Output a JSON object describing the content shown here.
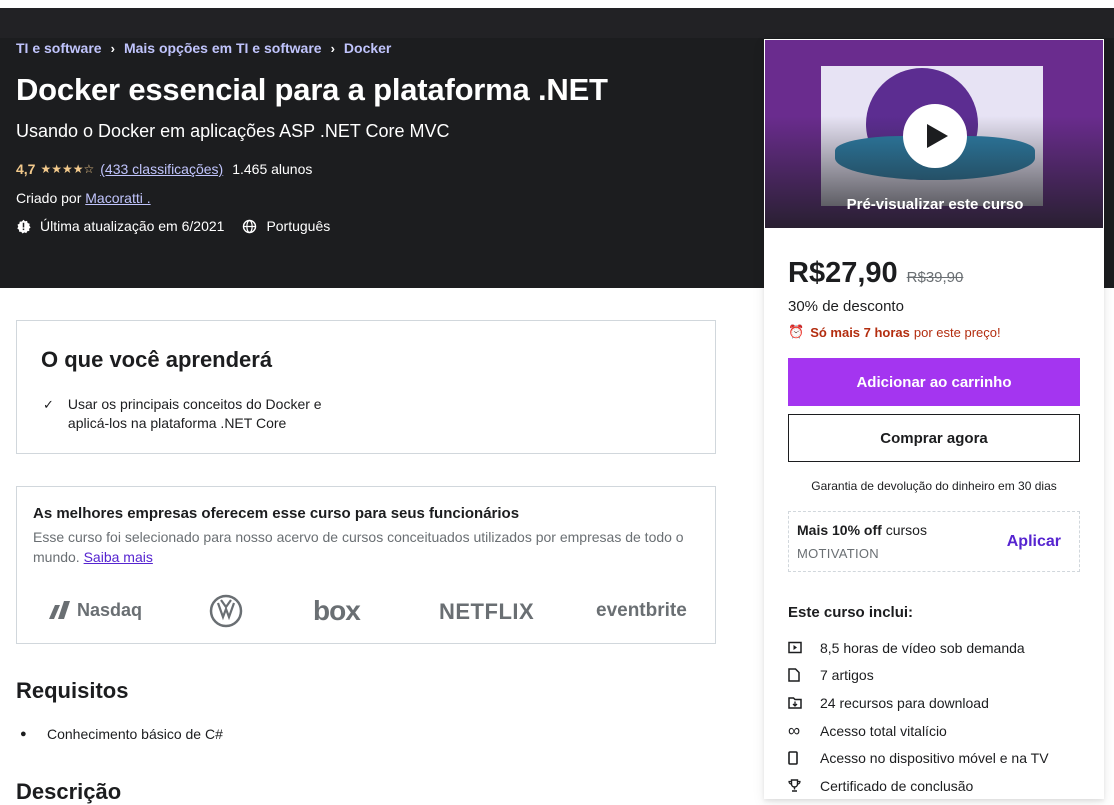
{
  "breadcrumb": [
    "TI e software",
    "Mais opções em TI e software",
    "Docker"
  ],
  "course": {
    "title": "Docker essencial para a plataforma .NET",
    "subtitle": "Usando o Docker em aplicações ASP .NET Core MVC",
    "rating": "4,7",
    "stars": "★★★★☆",
    "ratings_count": "(433 classificações)",
    "students": "1.465 alunos",
    "created_by_label": "Criado por",
    "author": "Macoratti .",
    "last_update": "Última atualização em 6/2021",
    "language": "Português"
  },
  "learn": {
    "title": "O que você aprenderá",
    "items": [
      "Usar os principais conceitos do Docker e aplicá-los na plataforma .NET Core"
    ]
  },
  "business": {
    "title": "As melhores empresas oferecem esse curso para seus funcionários",
    "text": "Esse curso foi selecionado para nosso acervo de cursos conceituados utilizados por empresas de todo o mundo.",
    "link": "Saiba mais",
    "logos": [
      "Nasdaq",
      "VW",
      "box",
      "NETFLIX",
      "eventbrite"
    ]
  },
  "requirements": {
    "title": "Requisitos",
    "items": [
      "Conhecimento básico de C#"
    ]
  },
  "description_title": "Descrição",
  "sidebar": {
    "preview_label": "Pré-visualizar este curso",
    "price": "R$27,90",
    "old_price": "R$39,90",
    "discount": "30% de desconto",
    "urgency_bold": "Só mais 7 horas",
    "urgency_rest": "por este preço!",
    "add_to_cart": "Adicionar ao carrinho",
    "buy_now": "Comprar agora",
    "guarantee": "Garantia de devolução do dinheiro em 30 dias",
    "coupon_bold": "Mais 10% off",
    "coupon_rest": "cursos",
    "coupon_code": "MOTIVATION",
    "apply": "Aplicar",
    "includes_title": "Este curso inclui:",
    "includes": [
      "8,5 horas de vídeo sob demanda",
      "7 artigos",
      "24 recursos para download",
      "Acesso total vitalício",
      "Acesso no dispositivo móvel e na TV",
      "Certificado de conclusão"
    ]
  },
  "colors": {
    "hero_bg": "#1c1d1f",
    "accent_purple": "#a435f0",
    "link_purple": "#5624d0",
    "star_gold": "#f3ca8c",
    "urgency_red": "#b32d0f"
  }
}
